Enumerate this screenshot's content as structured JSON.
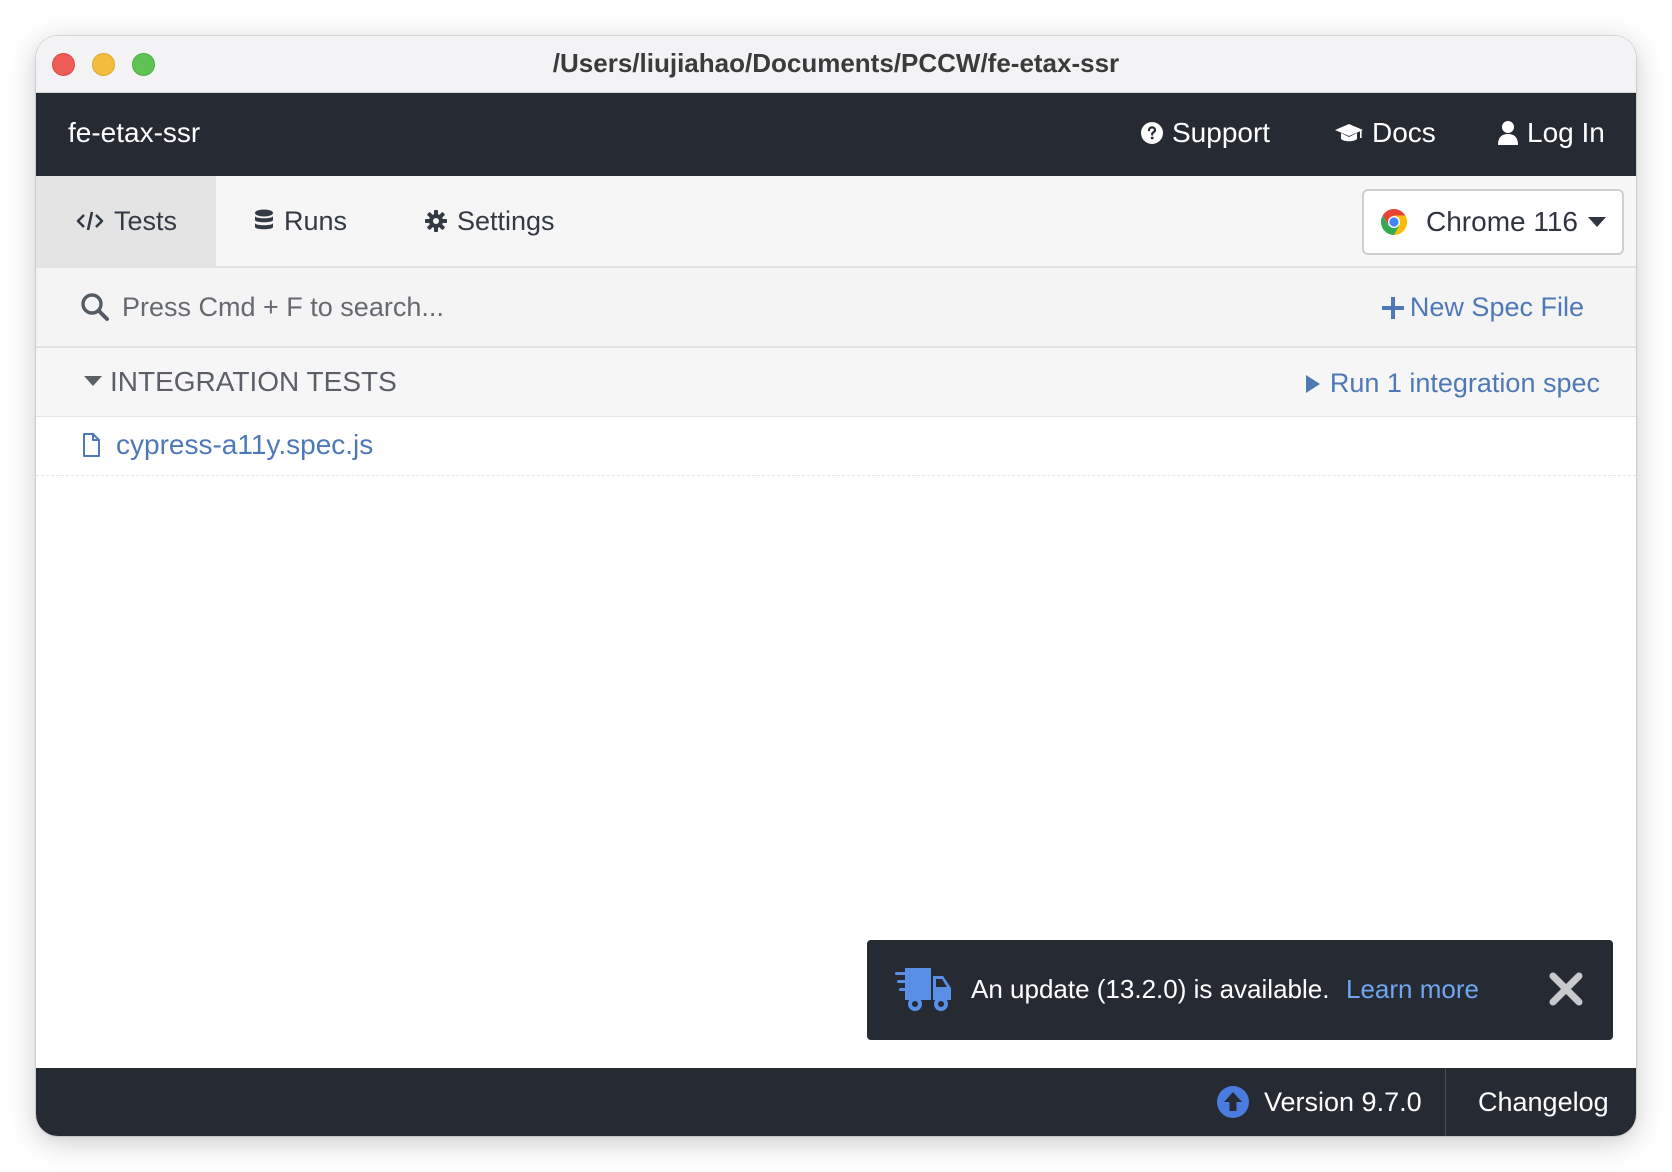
{
  "window": {
    "title": "/Users/liujiahao/Documents/PCCW/fe-etax-ssr"
  },
  "topnav": {
    "project_name": "fe-etax-ssr",
    "support_label": "Support",
    "docs_label": "Docs",
    "login_label": "Log In"
  },
  "tabs": [
    {
      "label": "Tests",
      "icon": "code-icon",
      "active": true
    },
    {
      "label": "Runs",
      "icon": "database-icon",
      "active": false
    },
    {
      "label": "Settings",
      "icon": "gear-icon",
      "active": false
    }
  ],
  "browser": {
    "selected": "Chrome 116",
    "icon": "chrome-icon"
  },
  "search": {
    "placeholder": "Press Cmd + F to search...",
    "value": ""
  },
  "new_spec_label": "New Spec File",
  "integration": {
    "title": "INTEGRATION TESTS",
    "run_label": "Run 1 integration spec",
    "specs": [
      {
        "name": "cypress-a11y.spec.js",
        "icon": "file-icon"
      }
    ]
  },
  "update_banner": {
    "message": "An update (13.2.0) is available.",
    "link_label": "Learn more",
    "icon": "truck-icon"
  },
  "footer": {
    "version_label": "Version 9.7.0",
    "changelog_label": "Changelog"
  },
  "colors": {
    "dark_nav": "#262a33",
    "link_blue": "#4f78b7",
    "banner_link": "#6fa6ef",
    "version_icon": "#4a7ce0",
    "truck_icon": "#5a8fe8"
  }
}
